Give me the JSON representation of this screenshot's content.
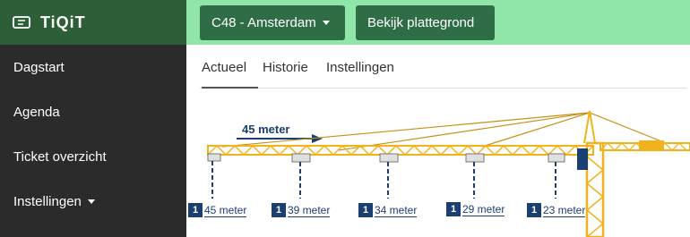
{
  "brand": {
    "name": "TiQiT",
    "icon": "ticket-icon"
  },
  "sidebar": {
    "items": [
      {
        "label": "Dagstart"
      },
      {
        "label": "Agenda"
      },
      {
        "label": "Ticket overzicht"
      },
      {
        "label": "Instellingen",
        "has_dropdown": true
      }
    ]
  },
  "topbar": {
    "location_button": "C48 - Amsterdam",
    "plan_button": "Bekijk plattegrond"
  },
  "tabs": [
    {
      "label": "Actueel",
      "active": true
    },
    {
      "label": "Historie",
      "active": false
    },
    {
      "label": "Instellingen",
      "active": false
    }
  ],
  "crane": {
    "jib_length_label": "45 meter",
    "markers": [
      {
        "count": "1",
        "label": "45 meter"
      },
      {
        "count": "1",
        "label": "39 meter"
      },
      {
        "count": "1",
        "label": "34 meter"
      },
      {
        "count": "1",
        "label": "29 meter"
      },
      {
        "count": "1",
        "label": "23 meter"
      }
    ]
  },
  "colors": {
    "sidebar_bg": "#2b2b2b",
    "brand_bg": "#2e5e38",
    "topbar_bg": "#8fe6a8",
    "button_bg": "#2f6d47",
    "crane_yellow": "#f2b21c",
    "marker_blue": "#1c3f72"
  }
}
